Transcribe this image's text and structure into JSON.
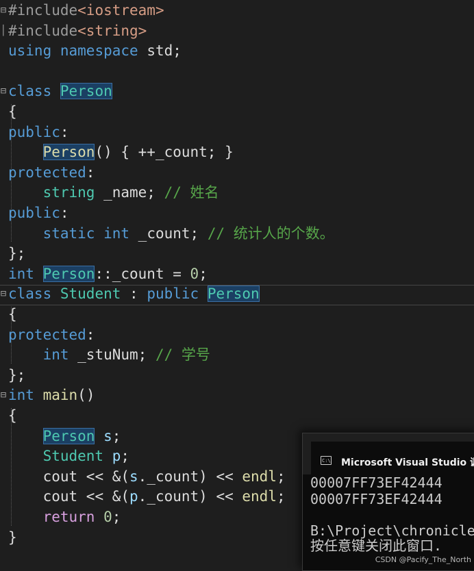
{
  "editor": {
    "colors": {
      "background": "#1e1e1e",
      "keyword": "#569cd6",
      "control_keyword": "#d8a0df",
      "type": "#4ec9b0",
      "function": "#dcdcaa",
      "variable": "#9cdcfe",
      "string": "#d69d85",
      "comment": "#57a64a",
      "number": "#b5cea8",
      "preprocessor": "#9b9b9b",
      "default": "#dcdcdc"
    },
    "lines": [
      [
        {
          "t": "#include",
          "c": "preprocessor"
        },
        {
          "t": "<iostream>",
          "c": "string"
        }
      ],
      [
        {
          "t": "#include",
          "c": "preprocessor"
        },
        {
          "t": "<string>",
          "c": "string"
        }
      ],
      [
        {
          "t": "using",
          "c": "keyword"
        },
        {
          "t": " "
        },
        {
          "t": "namespace",
          "c": "keyword"
        },
        {
          "t": " std;"
        }
      ],
      [],
      [
        {
          "t": "class",
          "c": "keyword"
        },
        {
          "t": " "
        },
        {
          "t": "Person",
          "c": "type",
          "box": true
        }
      ],
      [
        {
          "t": "{"
        }
      ],
      [
        {
          "t": "public",
          "c": "keyword"
        },
        {
          "t": ":"
        }
      ],
      [
        {
          "t": "    "
        },
        {
          "t": "Person",
          "c": "function",
          "box": true
        },
        {
          "t": "() { ++_count; }"
        }
      ],
      [
        {
          "t": "protected",
          "c": "keyword"
        },
        {
          "t": ":"
        }
      ],
      [
        {
          "t": "    "
        },
        {
          "t": "string",
          "c": "type"
        },
        {
          "t": " _name; "
        },
        {
          "t": "// 姓名",
          "c": "comment"
        }
      ],
      [
        {
          "t": "public",
          "c": "keyword"
        },
        {
          "t": ":"
        }
      ],
      [
        {
          "t": "    "
        },
        {
          "t": "static",
          "c": "keyword"
        },
        {
          "t": " "
        },
        {
          "t": "int",
          "c": "keyword"
        },
        {
          "t": " _count; "
        },
        {
          "t": "// 统计人的个数。",
          "c": "comment"
        }
      ],
      [
        {
          "t": "};"
        }
      ],
      [
        {
          "t": "int",
          "c": "keyword"
        },
        {
          "t": " "
        },
        {
          "t": "Person",
          "c": "type",
          "box": true
        },
        {
          "t": "::_count = "
        },
        {
          "t": "0",
          "c": "number"
        },
        {
          "t": ";"
        }
      ],
      [
        {
          "t": "class",
          "c": "keyword"
        },
        {
          "t": " "
        },
        {
          "t": "Student",
          "c": "type"
        },
        {
          "t": " : "
        },
        {
          "t": "public",
          "c": "keyword"
        },
        {
          "t": " "
        },
        {
          "t": "Person",
          "c": "type",
          "box": true
        }
      ],
      [
        {
          "t": "{"
        }
      ],
      [
        {
          "t": "protected",
          "c": "keyword"
        },
        {
          "t": ":"
        }
      ],
      [
        {
          "t": "    "
        },
        {
          "t": "int",
          "c": "keyword"
        },
        {
          "t": " _stuNum; "
        },
        {
          "t": "// 学号",
          "c": "comment"
        }
      ],
      [
        {
          "t": "};"
        }
      ],
      [
        {
          "t": "int",
          "c": "keyword"
        },
        {
          "t": " "
        },
        {
          "t": "main",
          "c": "function"
        },
        {
          "t": "()"
        }
      ],
      [
        {
          "t": "{"
        }
      ],
      [
        {
          "t": "    "
        },
        {
          "t": "Person",
          "c": "type",
          "box": true
        },
        {
          "t": " "
        },
        {
          "t": "s",
          "c": "variable"
        },
        {
          "t": ";"
        }
      ],
      [
        {
          "t": "    "
        },
        {
          "t": "Student",
          "c": "type"
        },
        {
          "t": " "
        },
        {
          "t": "p",
          "c": "variable"
        },
        {
          "t": ";"
        }
      ],
      [
        {
          "t": "    "
        },
        {
          "t": "cout",
          "c": "default"
        },
        {
          "t": " << &("
        },
        {
          "t": "s",
          "c": "variable"
        },
        {
          "t": "._count) << "
        },
        {
          "t": "endl",
          "c": "function"
        },
        {
          "t": ";"
        }
      ],
      [
        {
          "t": "    "
        },
        {
          "t": "cout",
          "c": "default"
        },
        {
          "t": " << &("
        },
        {
          "t": "p",
          "c": "variable"
        },
        {
          "t": "._count) << "
        },
        {
          "t": "endl",
          "c": "function"
        },
        {
          "t": ";"
        }
      ],
      [
        {
          "t": "    "
        },
        {
          "t": "return",
          "c": "control_keyword"
        },
        {
          "t": " "
        },
        {
          "t": "0",
          "c": "number"
        },
        {
          "t": ";"
        }
      ],
      [
        {
          "t": "}"
        }
      ]
    ],
    "fold_markers": [
      {
        "line": 0,
        "glyph": "⊟"
      },
      {
        "line": 1,
        "glyph": "│"
      },
      {
        "line": 4,
        "glyph": "⊟"
      },
      {
        "line": 14,
        "glyph": "⊟"
      },
      {
        "line": 19,
        "glyph": "⊟"
      }
    ]
  },
  "console": {
    "icon": "console-icon",
    "title": "Microsoft Visual Studio 调试",
    "output": [
      "00007FF73EF42444",
      "00007FF73EF42444",
      "",
      "B:\\Project\\chronicle",
      "按任意键关闭此窗口."
    ]
  },
  "watermark": "CSDN @Pacify_The_North"
}
